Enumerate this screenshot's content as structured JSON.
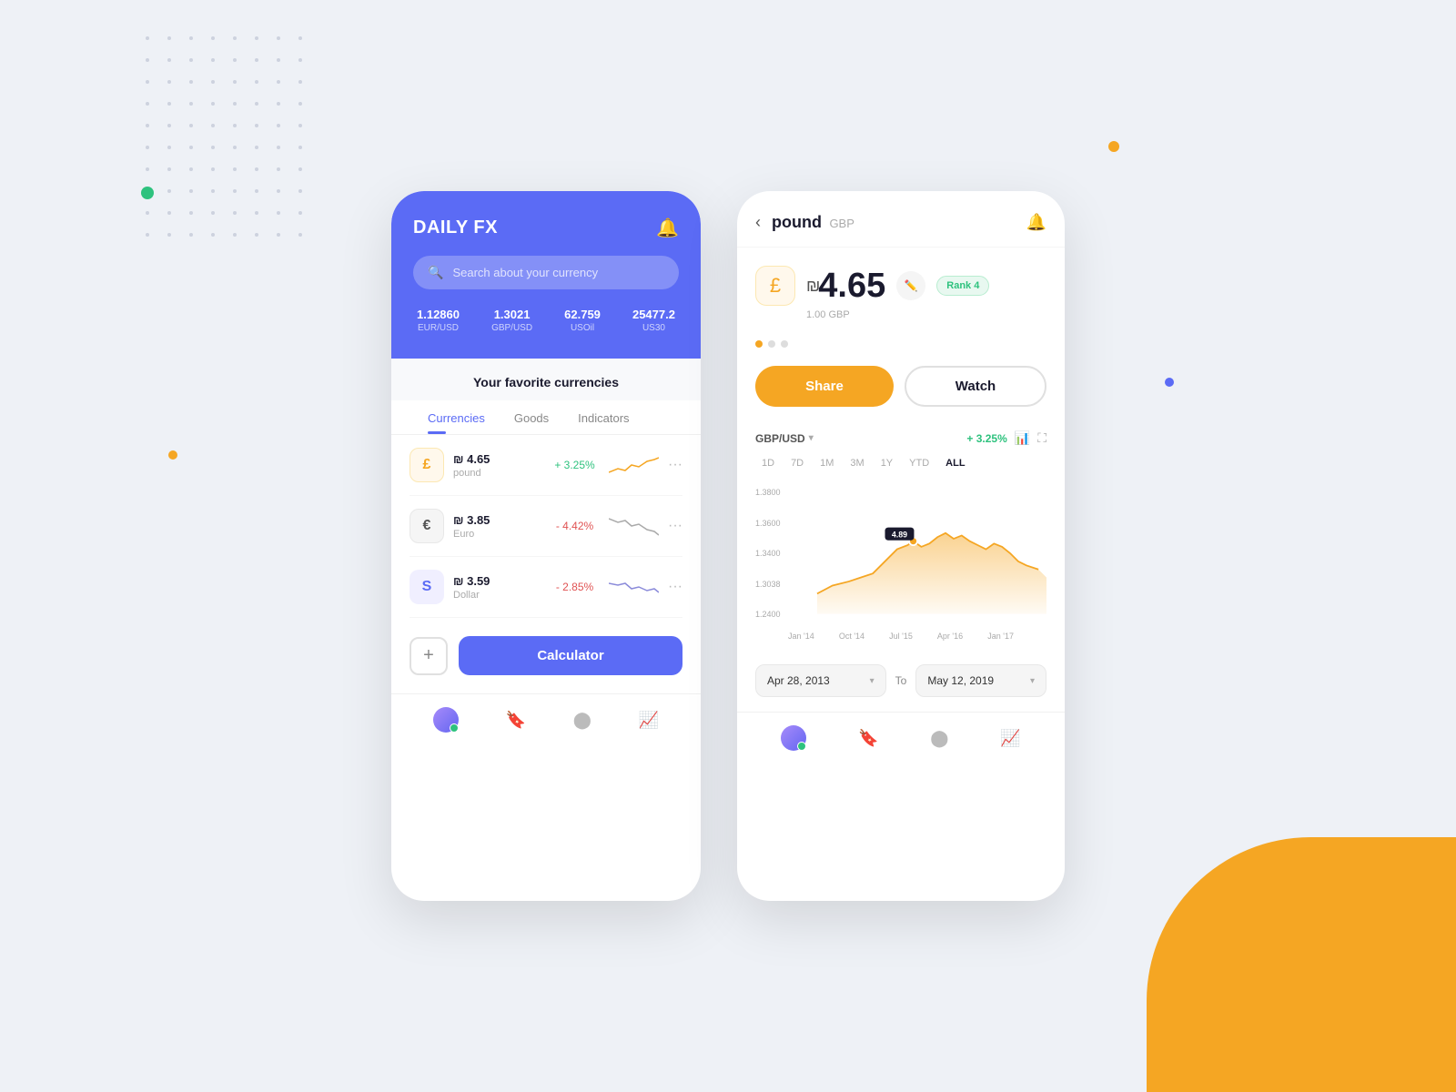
{
  "background": "#eef1f6",
  "phone1": {
    "header": {
      "title": "DAILY FX",
      "search_placeholder": "Search about your currency"
    },
    "tickers": [
      {
        "value": "1.12860",
        "label": "EUR/USD"
      },
      {
        "value": "1.3021",
        "label": "GBP/USD"
      },
      {
        "value": "62.759",
        "label": "USOil"
      },
      {
        "value": "25477.2",
        "label": "US30"
      }
    ],
    "favorites_title": "Your favorite currencies",
    "tabs": [
      "Currencies",
      "Goods",
      "Indicators"
    ],
    "active_tab": "Currencies",
    "currencies": [
      {
        "symbol": "£",
        "icon_class": "icon-pound",
        "value": "₪ 4.65",
        "name": "pound",
        "change": "+ 3.25%",
        "change_class": "change-pos"
      },
      {
        "symbol": "€",
        "icon_class": "icon-euro",
        "value": "₪ 3.85",
        "name": "Euro",
        "change": "- 4.42%",
        "change_class": "change-neg"
      },
      {
        "symbol": "S",
        "icon_class": "icon-dollar",
        "value": "₪ 3.59",
        "name": "Dollar",
        "change": "- 2.85%",
        "change_class": "change-neg"
      }
    ],
    "calculator_label": "Calculator",
    "plus_label": "+"
  },
  "phone2": {
    "header": {
      "currency_name": "pound",
      "currency_code": "GBP"
    },
    "price": "4.65",
    "base": "1.00 GBP",
    "rank": "Rank 4",
    "dots": [
      true,
      false,
      false
    ],
    "share_label": "Share",
    "watch_label": "Watch",
    "chart": {
      "pair": "GBP/USD",
      "change": "+ 3.25%",
      "time_filters": [
        "1D",
        "7D",
        "1M",
        "3M",
        "1Y",
        "YTD",
        "ALL"
      ],
      "active_filter": "ALL",
      "y_labels": [
        "1.3800",
        "1.3600",
        "1.3400",
        "1.3038",
        "1.2400"
      ],
      "x_labels": [
        "Jan '14",
        "Oct '14",
        "Jul '15",
        "Apr '16",
        "Jan '17"
      ],
      "tooltip_value": "4.89"
    },
    "date_from": "Apr 28, 2013",
    "date_to_label": "To",
    "date_to": "May 12, 2019"
  },
  "decorative": {
    "green_dot": {
      "color": "#2ec27e"
    },
    "orange_dot_left": {
      "color": "#F5A623"
    },
    "orange_dot_right": {
      "color": "#F5A623"
    },
    "blue_dot": {
      "color": "#5B6BF5"
    }
  }
}
